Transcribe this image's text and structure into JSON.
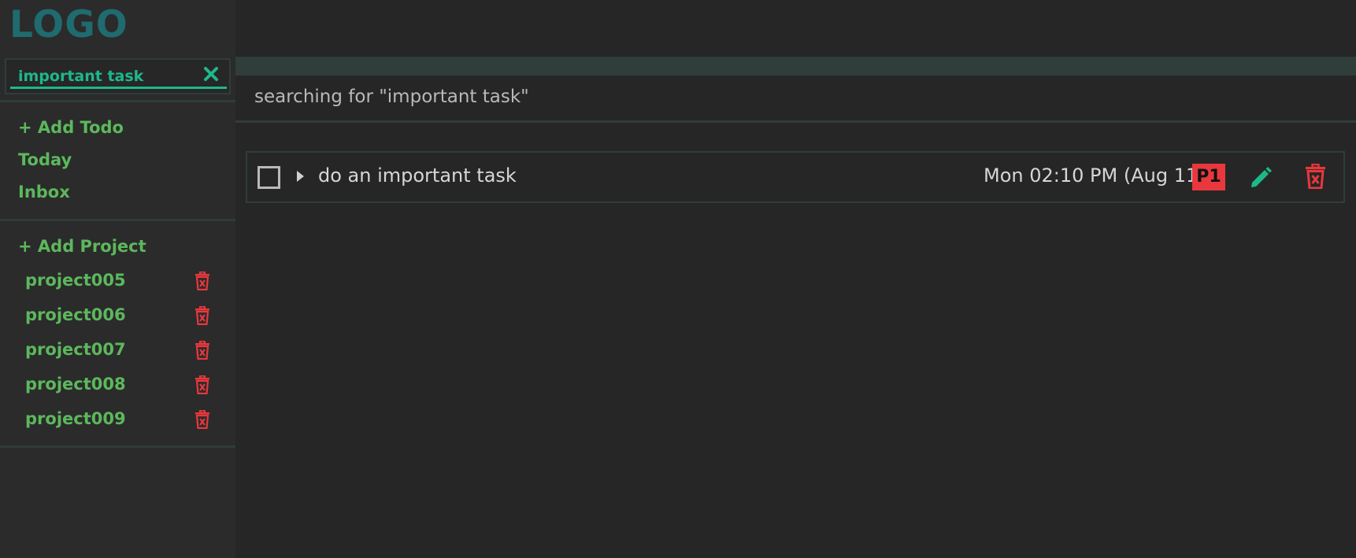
{
  "logo": "LOGO",
  "search": {
    "value": "important task",
    "clear_icon": "close-icon"
  },
  "nav": {
    "add_todo": "+ Add Todo",
    "today": "Today",
    "inbox": "Inbox",
    "add_project": "+ Add Project"
  },
  "projects": [
    {
      "label": "project005"
    },
    {
      "label": "project006"
    },
    {
      "label": "project007"
    },
    {
      "label": "project008"
    },
    {
      "label": "project009"
    }
  ],
  "main": {
    "search_heading": "searching for \"important task\""
  },
  "todos": [
    {
      "title": "do an important task",
      "due": "Mon 02:10 PM (Aug 11)",
      "priority": "P1",
      "checked": false
    }
  ],
  "colors": {
    "accent": "#1db88a",
    "nav_green": "#5cb85c",
    "danger": "#e8383d",
    "logo": "#1f6b6f"
  }
}
